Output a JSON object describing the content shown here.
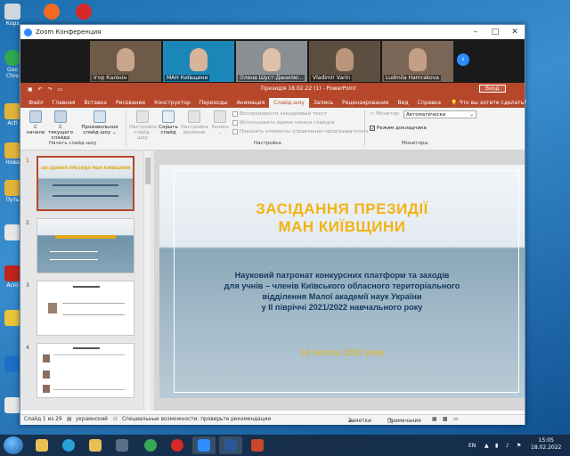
{
  "desktop": {
    "icons": [
      {
        "label": "Корз",
        "color": "#d0d7de"
      },
      {
        "label": "",
        "color": "#f26b21"
      },
      {
        "label": "",
        "color": "#d42a2a"
      },
      {
        "label": "Goo Chro",
        "color": "#2fa84f"
      },
      {
        "label": "Acti",
        "color": "#e2b33a"
      },
      {
        "label": "Нова",
        "color": "#e2b33a"
      },
      {
        "label": "Путь",
        "color": "#e2b33a"
      },
      {
        "label": "",
        "color": "#e8e8e8"
      },
      {
        "label": "Acro",
        "color": "#c0251d"
      },
      {
        "label": "",
        "color": "#e8c53a"
      },
      {
        "label": "",
        "color": "#1c6fc7"
      },
      {
        "label": "",
        "color": "#e8e8e8"
      }
    ]
  },
  "zoom": {
    "window_title": "Zoom Конференция",
    "participants": [
      {
        "name": "Ігор Калінін",
        "bg": "#6d5a49"
      },
      {
        "name": "МАН Київщини",
        "bg": "#1b86b8"
      },
      {
        "name": "Олена Шуст-Данилю...",
        "bg": "#8a8f93"
      },
      {
        "name": "Vladimir Varin",
        "bg": "#5d4f3f"
      },
      {
        "name": "Ludmila Hamrakova",
        "bg": "#7a6656"
      }
    ],
    "next_icon": "›"
  },
  "ppt": {
    "document_title": "Президія 18.02.22 (1) - PowerPoint",
    "sign_in": "Вход",
    "tabs": [
      "Файл",
      "Главная",
      "Вставка",
      "Рисование",
      "Конструктор",
      "Переходы",
      "Анимация",
      "Слайд-шоу",
      "Запись",
      "Рецензирование",
      "Вид",
      "Справка"
    ],
    "active_tab": "Слайд-шоу",
    "tell_me": "Что вы хотите сделать?",
    "ribbon": {
      "btn_from_start": "С начала",
      "btn_from_current": "С текущего слайда",
      "btn_custom": "Произвольное слайд-шоу ⌄",
      "group_start": "Начать слайд-шоу",
      "btn_setup": "Настройка слайд-шоу",
      "btn_hide": "Скрыть слайд",
      "btn_timing": "Настройка времени",
      "btn_record": "Запись ⌄",
      "chk_narration": "Воспроизвести закадровый текст",
      "chk_timings": "Использовать время показа слайдов",
      "chk_media": "Показать элементы управления проигрывателем",
      "group_setup": "Настройка",
      "monitor_label": "Монитор:",
      "monitor_value": "Автоматически",
      "chk_presenter": "Режим докладчика",
      "group_monitors": "Мониторы"
    },
    "thumbnails": [
      {
        "num": "1",
        "title": "ЗАСІДАННЯ ПРЕЗИДІЇ МАН КИЇВЩИНИ"
      },
      {
        "num": "2",
        "title": ""
      },
      {
        "num": "3",
        "title": ""
      },
      {
        "num": "4",
        "title": ""
      }
    ],
    "slide": {
      "title_line1": "ЗАСІДАННЯ ПРЕЗИДІЇ",
      "title_line2": "МАН КИЇВЩИНИ",
      "body_line1": "Науковий патронат конкурсних платформ та заходів",
      "body_line2": "для учнів – членів Київського обласного територіального",
      "body_line3": "відділення  Малої академії наук України",
      "body_line4": "у ІІ півріччі 2021/2022 навчального року",
      "date": "18 лютого  2022 року"
    },
    "status": {
      "slide_of": "Слайд 1 из 29",
      "language": "украинский",
      "accessibility": "Специальные возможности: проверьте рекомендации",
      "notes": "Заметки",
      "comments": "Примечания"
    }
  },
  "taskbar": {
    "apps": [
      {
        "name": "explorer",
        "color": "#e8c053"
      },
      {
        "name": "edge",
        "color": "#2aa0d8"
      },
      {
        "name": "files",
        "color": "#e8c053"
      },
      {
        "name": "chrome",
        "color": "#3aa757"
      },
      {
        "name": "opera",
        "color": "#d42a2a"
      },
      {
        "name": "zoom",
        "color": "#2d8cff"
      },
      {
        "name": "word",
        "color": "#2b5797"
      },
      {
        "name": "powerpoint",
        "color": "#c8472a"
      }
    ],
    "lang": "EN",
    "time": "15:05",
    "date": "18.02.2022"
  }
}
